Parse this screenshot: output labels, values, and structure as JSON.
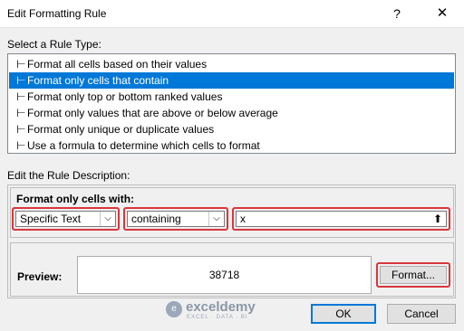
{
  "window": {
    "title": "Edit Formatting Rule",
    "help_glyph": "?",
    "close_glyph": "✕"
  },
  "rule_type": {
    "label": "Select a Rule Type:",
    "items": [
      {
        "label": "Format all cells based on their values"
      },
      {
        "label": "Format only cells that contain"
      },
      {
        "label": "Format only top or bottom ranked values"
      },
      {
        "label": "Format only values that are above or below average"
      },
      {
        "label": "Format only unique or duplicate values"
      },
      {
        "label": "Use a formula to determine which cells to format"
      }
    ],
    "selected_index": 1,
    "arrow_glyph": "⊢"
  },
  "description": {
    "label": "Edit the Rule Description:",
    "format_label": "Format only cells with:",
    "condition_select": "Specific Text",
    "operator_select": "containing",
    "value_input": "x",
    "dropdown_glyph": "⌵",
    "picker_glyph": "⬆"
  },
  "preview": {
    "label": "Preview:",
    "value": "38718"
  },
  "buttons": {
    "format": "Format...",
    "ok": "OK",
    "cancel": "Cancel"
  },
  "watermark": {
    "logo_glyph": "e",
    "name": "exceldemy",
    "tagline": "EXCEL · DATA · BI"
  },
  "colors": {
    "selection": "#0078d7",
    "highlight_border": "#d9363e"
  }
}
